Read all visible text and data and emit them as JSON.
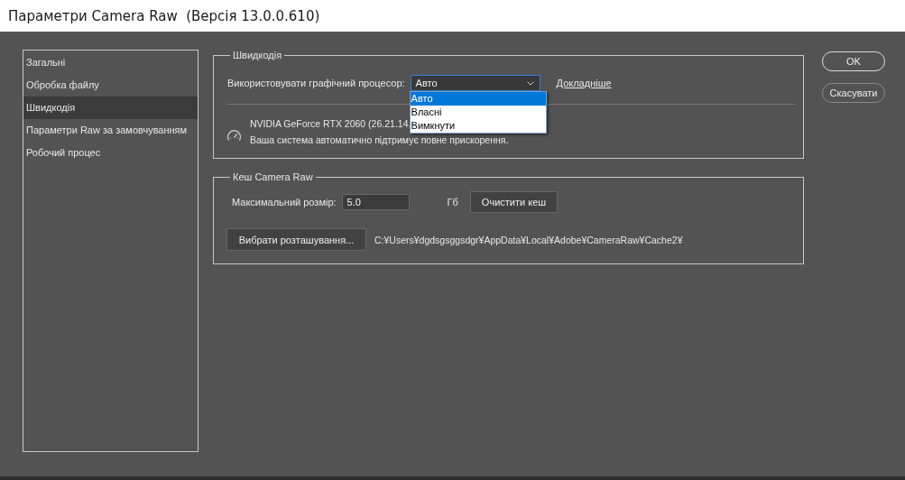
{
  "window": {
    "title": "Параметри Camera Raw  (Версія 13.0.0.610)"
  },
  "sidebar": {
    "items": [
      {
        "label": "Загальні",
        "selected": false
      },
      {
        "label": "Обробка файлу",
        "selected": false
      },
      {
        "label": "Швидкодія",
        "selected": true
      },
      {
        "label": "Параметри Raw за замовчуванням",
        "selected": false
      },
      {
        "label": "Робочий процес",
        "selected": false
      }
    ]
  },
  "performance": {
    "legend": "Швидкодія",
    "gpu_label": "Використовувати графічний процесор:",
    "gpu_select": {
      "value": "Авто",
      "expanded": true,
      "options": [
        {
          "label": "Авто",
          "selected": true
        },
        {
          "label": "Власні",
          "selected": false
        },
        {
          "label": "Вимкнути",
          "selected": false
        }
      ]
    },
    "more_link": "Докладніше",
    "gpu_name": "NVIDIA GeForce RTX 2060 (26.21.14.",
    "gpu_status": "Ваша система автоматично підтримує повне прискорення."
  },
  "cache": {
    "legend": "Кеш Camera Raw",
    "max_size_label": "Максимальний розмір:",
    "max_size_value": "5.0",
    "unit": "Гб",
    "purge_button": "Очистити кеш",
    "choose_button": "Вибрати розташування...",
    "path": "C:¥Users¥dgdsgsggsdgr¥AppData¥Local¥Adobe¥CameraRaw¥Cache2¥"
  },
  "buttons": [
    {
      "label": "OK",
      "kind": "primary"
    },
    {
      "label": "Скасувати",
      "kind": "secondary"
    }
  ]
}
